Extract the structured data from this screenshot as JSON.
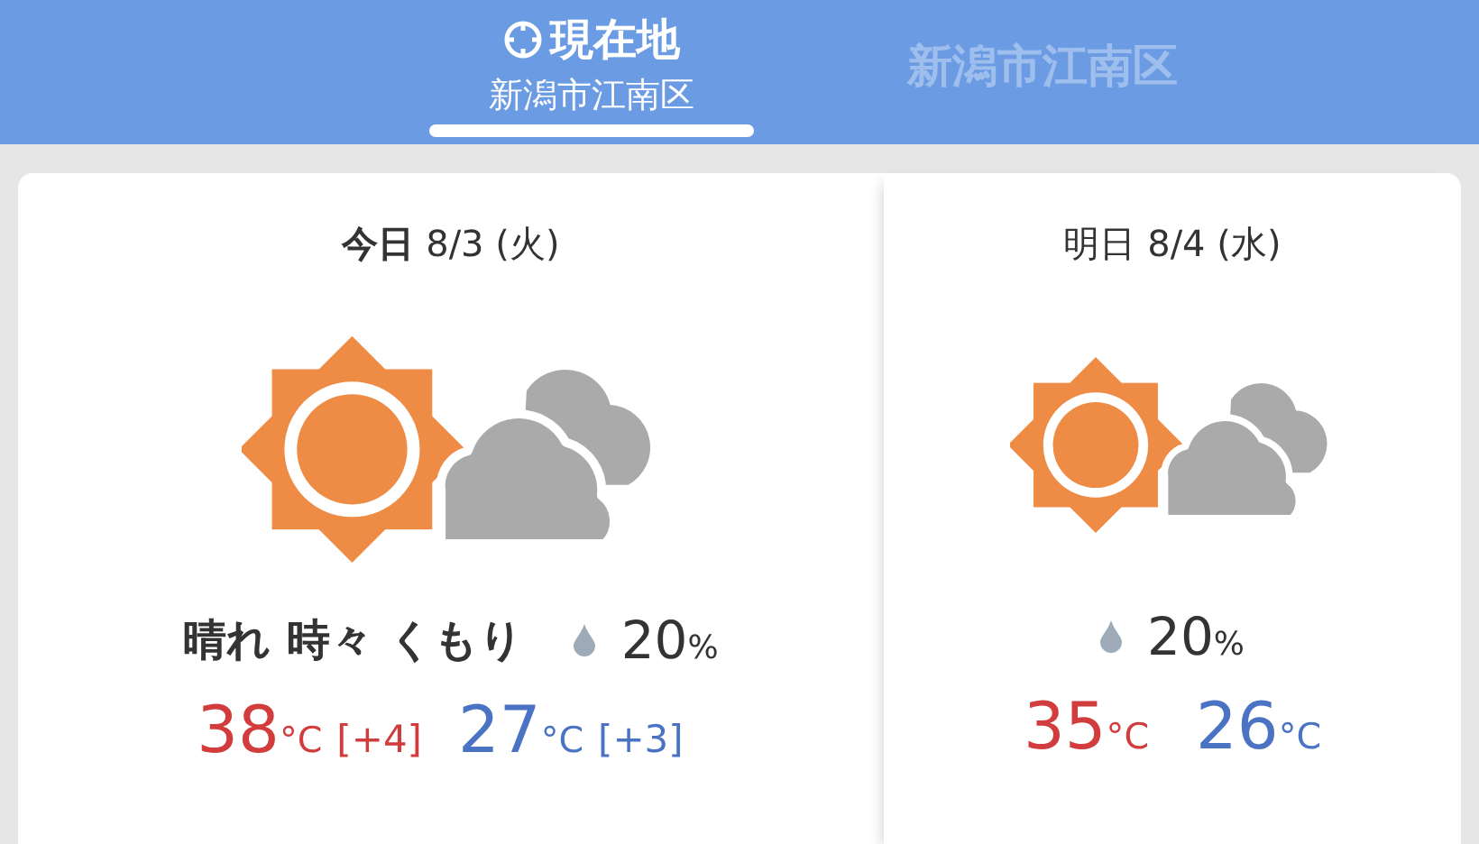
{
  "tabs": [
    {
      "title": "現在地",
      "subtitle": "新潟市江南区",
      "current_location": true,
      "selected": true
    },
    {
      "title": "新潟市江南区",
      "current_location": false,
      "selected": false
    }
  ],
  "days": [
    {
      "date": "**今日** 8/3 (火)",
      "weather": "晴れ 時々 くもり",
      "pop": "20",
      "pop_unit": "%",
      "high": "38",
      "high_unit": "°C",
      "high_diff": "[+4]",
      "low": "27",
      "low_unit": "°C",
      "low_diff": "[+3]",
      "kind": "today"
    },
    {
      "date": "明日 8/4 (水)",
      "pop": "20",
      "pop_unit": "%",
      "high": "35",
      "high_unit": "°C",
      "low": "26",
      "low_unit": "°C",
      "kind": "tomorrow"
    }
  ]
}
